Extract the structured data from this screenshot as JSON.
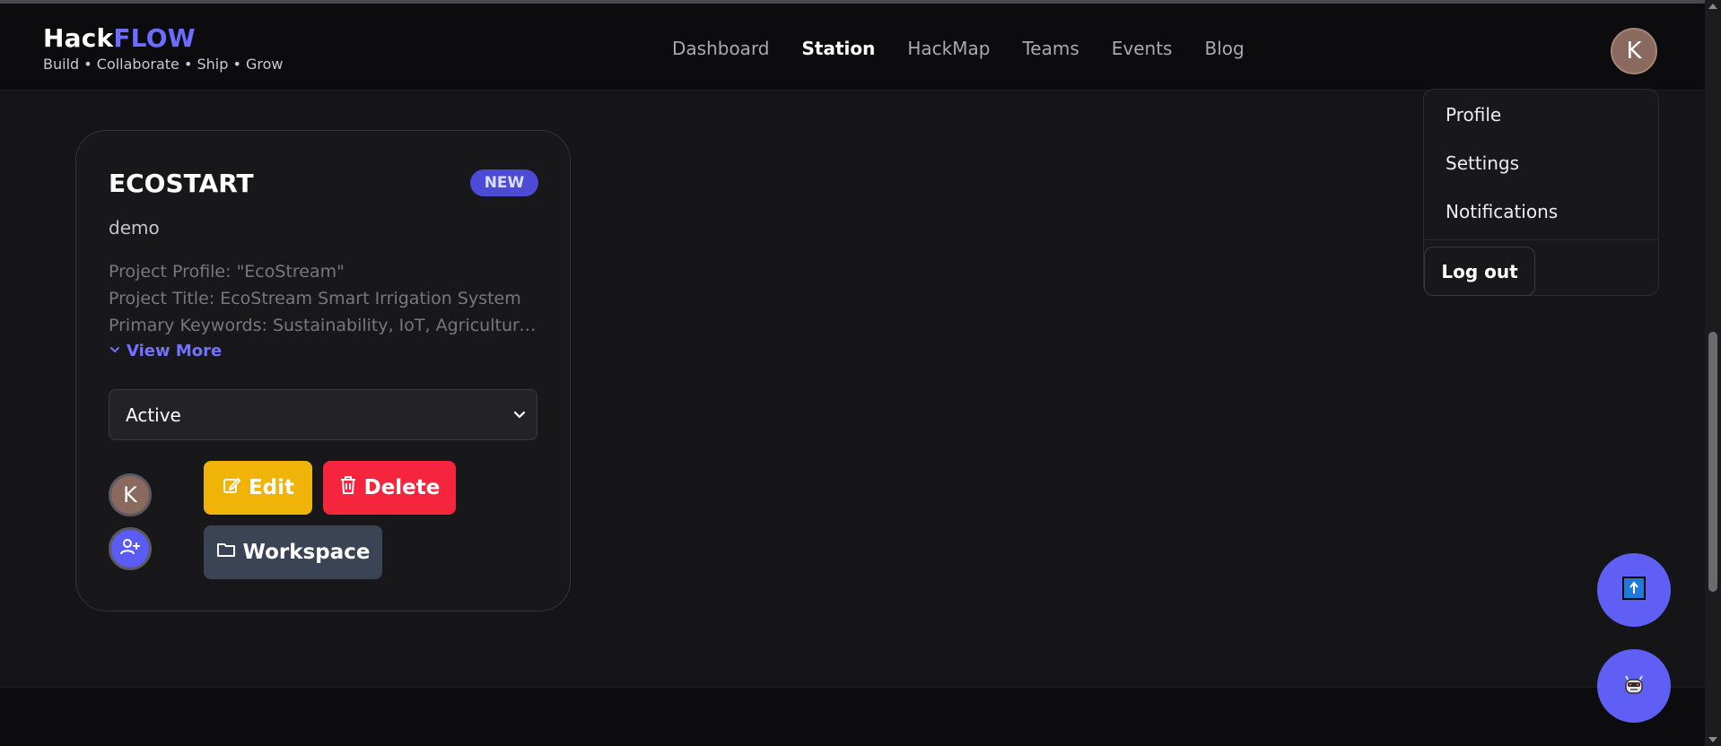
{
  "brand": {
    "title_part1": "Hack",
    "title_part2": "FLOW",
    "tagline": "Build • Collaborate • Ship • Grow",
    "accent_color": "#6c6cff"
  },
  "nav": {
    "items": [
      {
        "label": "Dashboard",
        "active": false
      },
      {
        "label": "Station",
        "active": true
      },
      {
        "label": "HackMap",
        "active": false
      },
      {
        "label": "Teams",
        "active": false
      },
      {
        "label": "Events",
        "active": false
      },
      {
        "label": "Blog",
        "active": false
      }
    ]
  },
  "user": {
    "initial": "K"
  },
  "dropdown": {
    "items": [
      "Profile",
      "Settings",
      "Notifications"
    ],
    "logout": "Log out"
  },
  "card": {
    "title": "ECOSTART",
    "badge": "NEW",
    "subtitle": "demo",
    "description_lines": [
      "Project Profile: \"EcoStream\"",
      "Project Title: EcoStream Smart Irrigation System",
      "Primary Keywords: Sustainability, IoT, Agriculture, ..."
    ],
    "view_more": "View More",
    "status_select": "Active",
    "member_initial": "K",
    "buttons": {
      "edit": "Edit",
      "delete": "Delete",
      "workspace": "Workspace"
    },
    "colors": {
      "edit": "#f0b308",
      "delete": "#f4253d",
      "workspace": "#3b4455",
      "badge": "#4b4bd6"
    }
  },
  "fab": {
    "upload_icon": "upload-arrow-icon",
    "bot_icon": "robot-icon",
    "color": "#5f5ff5"
  }
}
